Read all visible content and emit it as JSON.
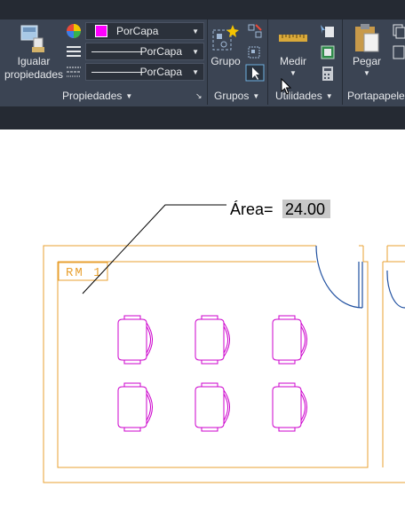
{
  "ribbon": {
    "panels": {
      "propiedades": "Propiedades",
      "grupos": "Grupos",
      "utilidades": "Utilidades",
      "portapapeles": "Portapapeles"
    },
    "buttons": {
      "igualar_line1": "Igualar",
      "igualar_line2": "propiedades",
      "grupo": "Grupo",
      "medir": "Medir",
      "pegar": "Pegar"
    },
    "combos": {
      "color": "PorCapa",
      "linetype": "PorCapa",
      "lineweight": "PorCapa"
    },
    "colors": {
      "color_swatch": "#ff00ff",
      "ribbon_bg": "#3b4453"
    }
  },
  "drawing": {
    "room_tag": "RM 1",
    "area_label": "Área=",
    "area_value": "24.00",
    "colors": {
      "walls": "#e8a030",
      "furniture": "#cc00cc",
      "door": "#2050a0"
    }
  }
}
